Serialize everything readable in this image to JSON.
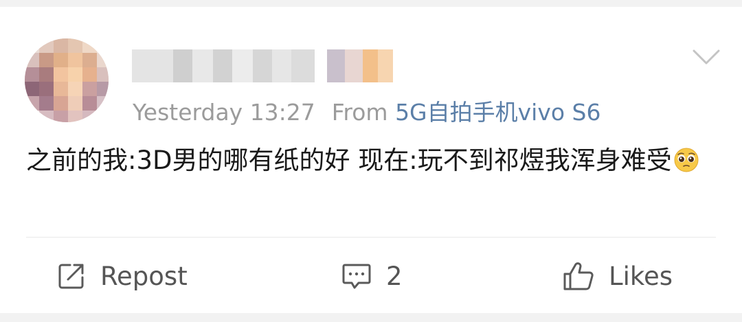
{
  "post": {
    "timestamp": "Yesterday 13:27",
    "source_prefix": "From",
    "device": "5G自拍手机vivo S6",
    "text": "之前的我:3D男的哪有纸的好 现在:玩不到祁煜我浑身难受"
  },
  "actions": {
    "repost_label": "Repost",
    "comment_count": "2",
    "likes_label": "Likes"
  },
  "icons": {
    "menu": "chevron-down-icon",
    "repost": "share-out-icon",
    "comment": "speech-bubble-icon",
    "like": "thumbs-up-icon",
    "emoji": "pleading-face-emoji"
  },
  "colors": {
    "meta_gray": "#9b9b9b",
    "device_link": "#5b7fa8",
    "text": "#1a1a1a",
    "action_gray": "#555555"
  }
}
